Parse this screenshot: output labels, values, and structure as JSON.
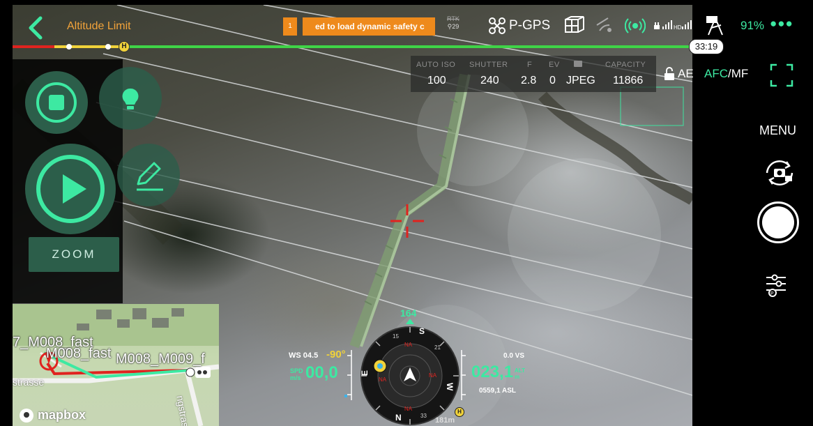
{
  "header": {
    "title": "Altitude Limit",
    "alert_index": "1",
    "alert_text": "ed to load dynamic safety c",
    "rtk_label": "RTK",
    "rtk_count": "29",
    "gps_mode": "P-GPS",
    "signal_label": "HD",
    "battery": "91%"
  },
  "timeline": {
    "remaining": "33:19",
    "progress": 0.18
  },
  "camera": {
    "iso": {
      "label": "AUTO ISO",
      "value": "100"
    },
    "shutter": {
      "label": "SHUTTER",
      "value": "240"
    },
    "fstop": {
      "label": "F",
      "value": "2.8"
    },
    "ev": {
      "label": "EV",
      "value": "0"
    },
    "format": {
      "label": "",
      "value": "JPEG"
    },
    "capacity": {
      "label": "CAPACITY",
      "value": "11866"
    },
    "ae_label": "AE",
    "afc_label": "AFC",
    "mf_label": "/MF"
  },
  "right_panel": {
    "menu_label": "MENU"
  },
  "left_panel": {
    "zoom_label": "ZOOM"
  },
  "map": {
    "label_1": "7_M008_fast",
    "label_2": "M008_fast",
    "label_3": "M008_M009_f",
    "street_1": "strasse",
    "street_2": "ngstras",
    "attribution": "mapbox"
  },
  "hud": {
    "wind_label": "WS 04.5",
    "gimbal_pitch": "-90°",
    "speed_label_1": "SPD",
    "speed_label_2": "m/s",
    "speed_value": "00,0",
    "heading": "164",
    "vs_label": "0.0 VS",
    "altitude_value": "023,1",
    "alt_unit_1": "ALT",
    "alt_unit_2": "m",
    "asl_label": "0559,1 ASL",
    "distance": "181m",
    "compass_n": "N",
    "compass_s": "S",
    "compass_e": "E",
    "compass_w": "W",
    "compass_na": "NA",
    "compass_15": "15",
    "compass_21": "21",
    "compass_33": "33"
  },
  "colors": {
    "accent": "#3de9a2",
    "alert": "#ee8a1c",
    "title": "#f2a33a",
    "reticle": "#e0231f"
  }
}
